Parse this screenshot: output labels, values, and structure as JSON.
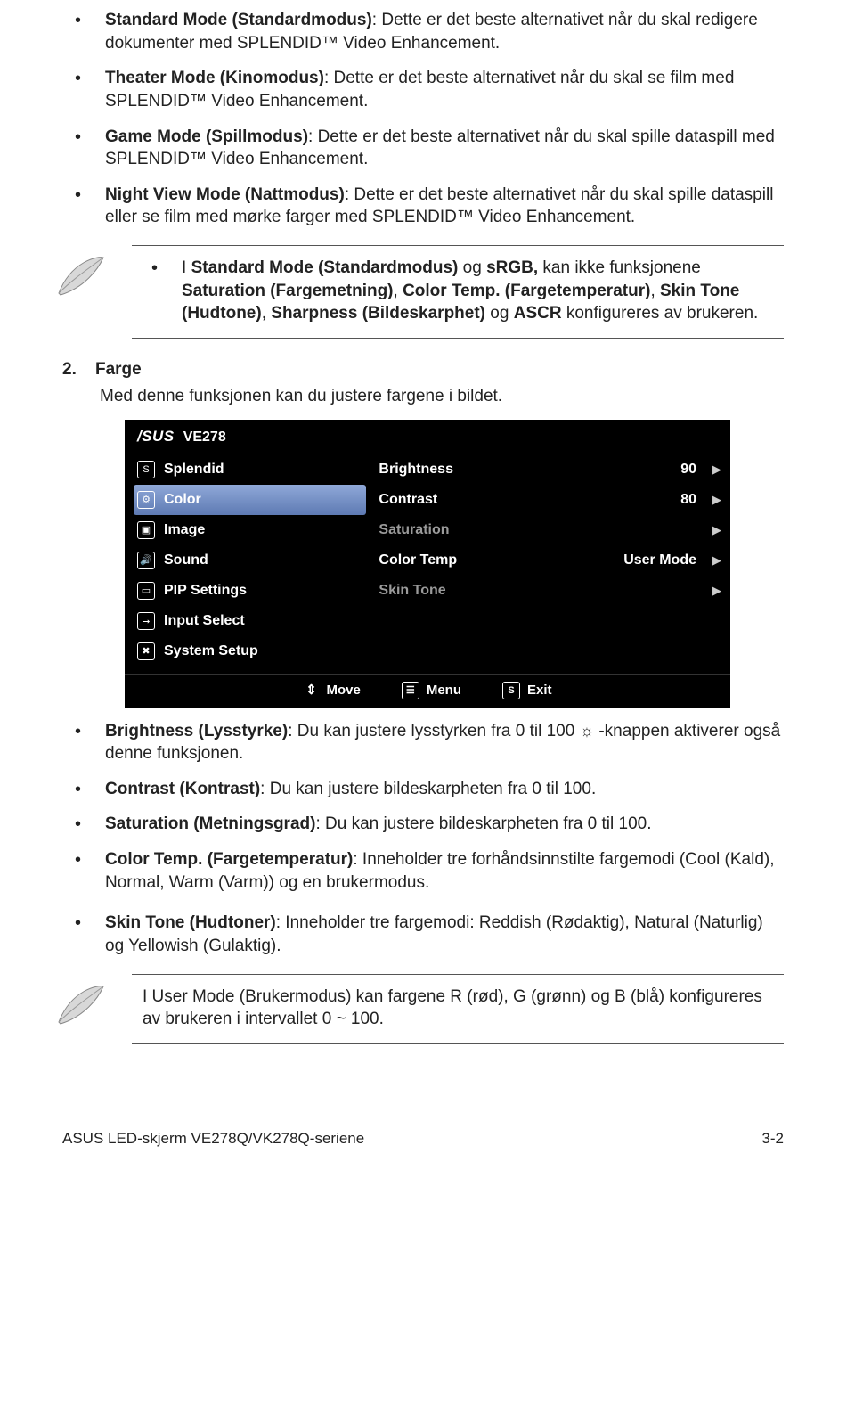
{
  "bullets_top": [
    {
      "title": "Standard Mode (Standardmodus)",
      "text": ": Dette er det beste alternativet når du skal redigere dokumenter med SPLENDID™ Video Enhancement."
    },
    {
      "title": "Theater Mode (Kinomodus)",
      "text": ": Dette er det beste alternativet når du skal se film med SPLENDID™ Video Enhancement."
    },
    {
      "title": "Game Mode (Spillmodus)",
      "text": ": Dette er det beste alternativet når du skal spille dataspill med SPLENDID™ Video Enhancement."
    },
    {
      "title": "Night View Mode (Nattmodus)",
      "text": ": Dette er det beste alternativet når du skal spille dataspill eller se film med mørke farger med SPLENDID™ Video Enhancement."
    }
  ],
  "note1_parts": [
    {
      "t": "I ",
      "b": false
    },
    {
      "t": "Standard Mode (Standardmodus)",
      "b": true
    },
    {
      "t": " og ",
      "b": false
    },
    {
      "t": "sRGB,",
      "b": true
    },
    {
      "t": " kan ikke funksjonene ",
      "b": false
    },
    {
      "t": "Saturation (Fargemetning)",
      "b": true
    },
    {
      "t": ", ",
      "b": false
    },
    {
      "t": "Color Temp. (Fargetemperatur)",
      "b": true
    },
    {
      "t": ", ",
      "b": false
    },
    {
      "t": "Skin Tone (Hudtone)",
      "b": true
    },
    {
      "t": ", ",
      "b": false
    },
    {
      "t": "Sharpness (Bildeskarphet)",
      "b": true
    },
    {
      "t": " og ",
      "b": false
    },
    {
      "t": "ASCR",
      "b": true
    },
    {
      "t": " konfigureres av brukeren.",
      "b": false
    }
  ],
  "section": {
    "num": "2.",
    "title": "Farge",
    "desc": "Med denne funksjonen kan du justere fargene i bildet."
  },
  "osd": {
    "model": "VE278",
    "left": [
      {
        "icon": "S",
        "label": "Splendid"
      },
      {
        "icon": "⚙",
        "label": "Color",
        "selected": true
      },
      {
        "icon": "▣",
        "label": "Image"
      },
      {
        "icon": "🔊",
        "label": "Sound"
      },
      {
        "icon": "▭",
        "label": "PIP Settings"
      },
      {
        "icon": "⭢",
        "label": "Input Select"
      },
      {
        "icon": "✖",
        "label": "System Setup"
      }
    ],
    "right": [
      {
        "label": "Brightness",
        "value": "90",
        "dim": false
      },
      {
        "label": "Contrast",
        "value": "80",
        "dim": false
      },
      {
        "label": "Saturation",
        "value": "",
        "dim": true
      },
      {
        "label": "Color Temp",
        "value": "User Mode",
        "dim": false
      },
      {
        "label": "Skin Tone",
        "value": "",
        "dim": true
      }
    ],
    "bottom": {
      "move": "Move",
      "menu": "Menu",
      "exit": "Exit"
    }
  },
  "bullets_bottom": [
    {
      "title": "Brightness (Lysstyrke)",
      "text": ": Du kan justere lysstyrken fra 0 til 100 ",
      "tail": " -knappen aktiverer også denne funksjonen.",
      "sun": true
    },
    {
      "title": "Contrast (Kontrast)",
      "text": ": Du kan justere bildeskarpheten fra 0 til 100."
    },
    {
      "title": "Saturation (Metningsgrad)",
      "text": ": Du kan justere bildeskarpheten fra 0 til 100."
    },
    {
      "title": "Color Temp. (Fargetemperatur)",
      "text": ": Inneholder tre forhåndsinnstilte fargemodi (Cool (Kald), Normal, Warm (Varm)) og en brukermodus."
    },
    {
      "title": "Skin Tone (Hudtoner)",
      "text": ": Inneholder tre fargemodi: Reddish (Rødaktig), Natural (Naturlig) og Yellowish (Gulaktig)."
    }
  ],
  "note2": "I User Mode (Brukermodus) kan fargene R (rød), G (grønn) og B (blå) konfigureres av brukeren i intervallet 0 ~ 100.",
  "footer": {
    "left": "ASUS LED-skjerm VE278Q/VK278Q-seriene",
    "right": "3-2"
  }
}
